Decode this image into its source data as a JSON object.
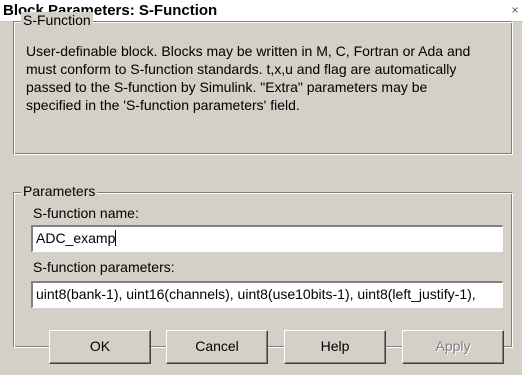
{
  "window": {
    "title": "Block Parameters: S-Function",
    "close_glyph": "×"
  },
  "sfunction_group": {
    "legend": "S-Function",
    "description_lines": [
      "User-definable block.  Blocks may be written in M, C, Fortran or Ada and",
      "must  conform to S-function standards.  t,x,u and flag are automatically",
      "passed to the S-function by Simulink.  \"Extra\" parameters may be",
      "specified in the 'S-function parameters' field."
    ]
  },
  "parameters_group": {
    "legend": "Parameters",
    "sfunction_name_label": "S-function name:",
    "sfunction_name_value": "ADC_examp",
    "sfunction_params_label": "S-function parameters:",
    "sfunction_params_value": "uint8(bank-1), uint16(channels), uint8(use10bits-1), uint8(left_justify-1),"
  },
  "buttons": {
    "ok": "OK",
    "cancel": "Cancel",
    "help": "Help",
    "apply": "Apply"
  }
}
